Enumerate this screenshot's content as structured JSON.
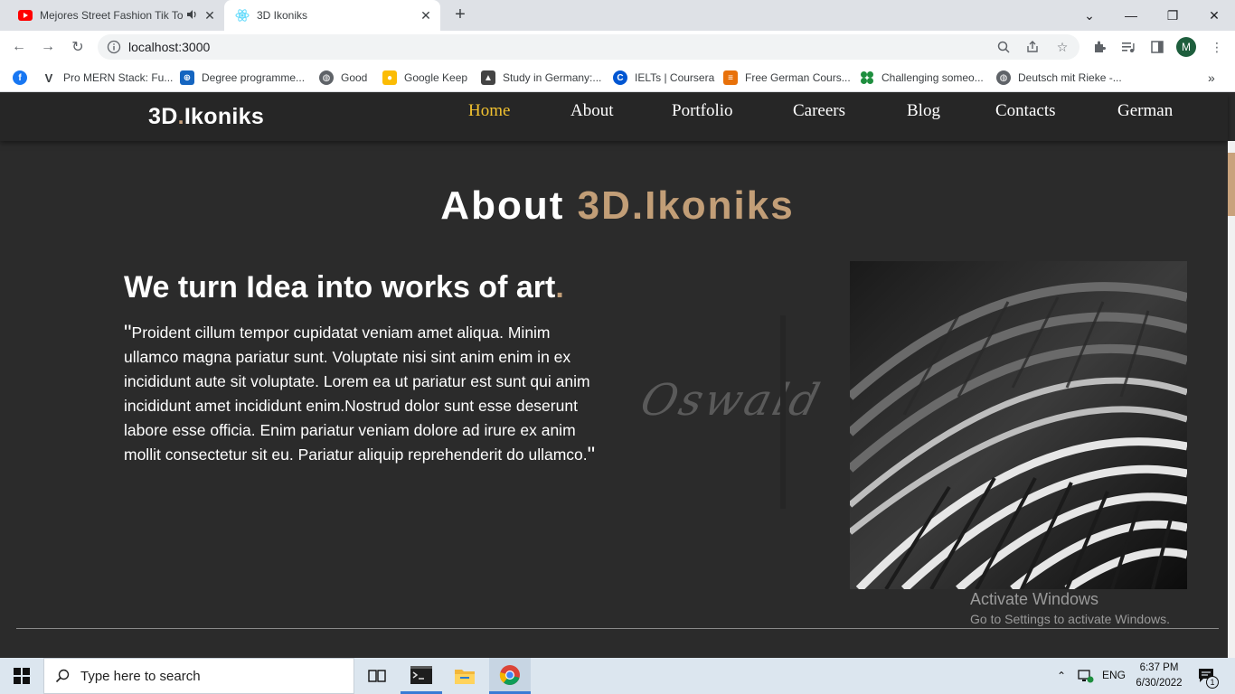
{
  "browser": {
    "tabs": [
      {
        "title": "Mejores Street Fashion Tik To",
        "favicon": "youtube-icon",
        "audio": true
      },
      {
        "title": "3D Ikoniks",
        "favicon": "react-icon",
        "active": true
      }
    ],
    "url": "localhost:3000",
    "profile_initial": "M",
    "bookmarks": [
      {
        "label": "",
        "icon": "facebook-icon"
      },
      {
        "label": "Pro MERN Stack: Fu...",
        "icon": "v-icon"
      },
      {
        "label": "Degree programme...",
        "icon": "shield-icon"
      },
      {
        "label": "Good",
        "icon": "globe-icon"
      },
      {
        "label": "Google Keep",
        "icon": "keep-icon"
      },
      {
        "label": "Study in Germany:...",
        "icon": "study-icon"
      },
      {
        "label": "IELTs | Coursera",
        "icon": "coursera-icon"
      },
      {
        "label": "Free German Cours...",
        "icon": "books-icon"
      },
      {
        "label": "Challenging someo...",
        "icon": "clover-icon"
      },
      {
        "label": "Deutsch mit Rieke -...",
        "icon": "globe-icon"
      }
    ]
  },
  "site": {
    "logo_main": "3D",
    "logo_dot": ".",
    "logo_rest": "Ikoniks",
    "nav": [
      "Home",
      "About",
      "Portfolio",
      "Careers",
      "Blog",
      "Contacts",
      "German"
    ],
    "active_nav": "Home",
    "accent_color": "#c29e77",
    "active_color": "#f2c230"
  },
  "about": {
    "title_white": "About",
    "title_accent": "3D.Ikoniks",
    "headline": "We turn Idea into works of art",
    "headline_dot": ".",
    "quote_open": "\"",
    "quote": "Proident cillum tempor cupidatat veniam amet aliqua. Minim ullamco magna pariatur sunt. Voluptate nisi sint anim enim in ex incididunt aute sit voluptate. Lorem ea ut pariatur est sunt qui anim incididunt amet incididunt enim.Nostrud dolor sunt esse deserunt labore esse officia. Enim pariatur veniam dolore ad irure ex anim mollit consectetur sit eu. Pariatur aliquip reprehenderit do ullamco.",
    "quote_close": "\"",
    "signature": "Oswald"
  },
  "watermark": {
    "line1": "Activate Windows",
    "line2": "Go to Settings to activate Windows."
  },
  "taskbar": {
    "search_placeholder": "Type here to search",
    "language": "ENG",
    "time": "6:37 PM",
    "date": "6/30/2022",
    "notification_count": "1"
  }
}
